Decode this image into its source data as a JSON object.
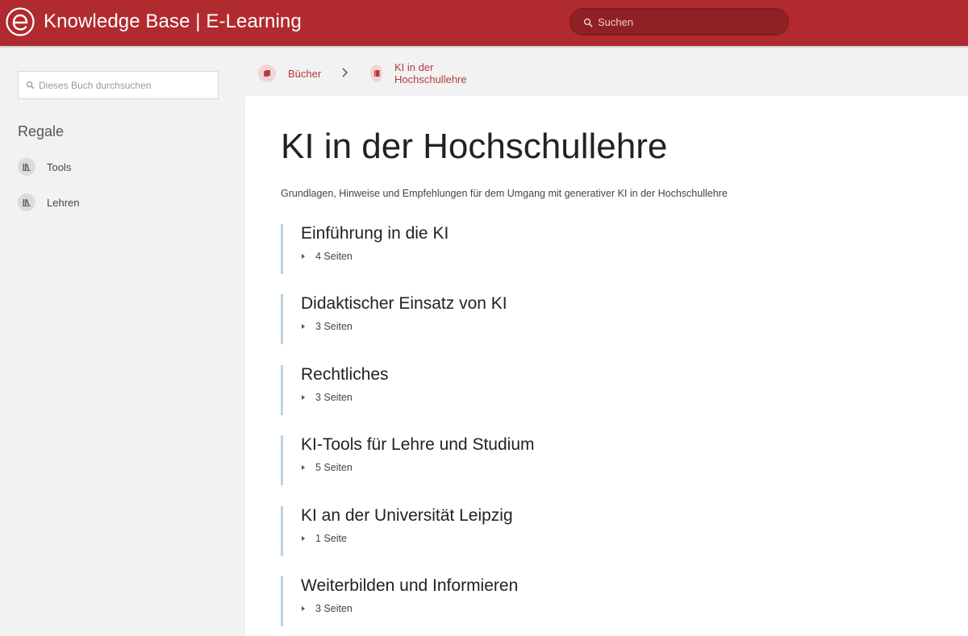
{
  "header": {
    "title": "Knowledge Base | E-Learning",
    "search_placeholder": "Suchen",
    "brand_color": "#b12a2f"
  },
  "sidebar": {
    "search_placeholder": "Dieses Buch durchsuchen",
    "shelves_heading": "Regale",
    "shelves": [
      {
        "label": "Tools",
        "icon": "bookshelf-icon"
      },
      {
        "label": "Lehren",
        "icon": "bookshelf-icon"
      }
    ]
  },
  "breadcrumb": [
    {
      "label": "Bücher",
      "icon": "books-icon"
    },
    {
      "label": "KI in der Hochschullehre",
      "icon": "book-icon"
    }
  ],
  "book": {
    "title": "KI in der Hochschullehre",
    "description": "Grundlagen, Hinweise und Empfehlungen für dem Umgang mit generativer KI in der Hochschullehre",
    "chapters": [
      {
        "title": "Einführung in die KI",
        "pages": "4 Seiten"
      },
      {
        "title": "Didaktischer Einsatz von KI",
        "pages": "3 Seiten"
      },
      {
        "title": "Rechtliches",
        "pages": "3 Seiten"
      },
      {
        "title": "KI-Tools für Lehre und Studium",
        "pages": "5 Seiten"
      },
      {
        "title": "KI an der Universität Leipzig",
        "pages": "1 Seite"
      },
      {
        "title": "Weiterbilden und Informieren",
        "pages": "3 Seiten"
      }
    ]
  },
  "colors": {
    "chapter_border": "#b9d5e6",
    "link": "#b23a3f"
  }
}
